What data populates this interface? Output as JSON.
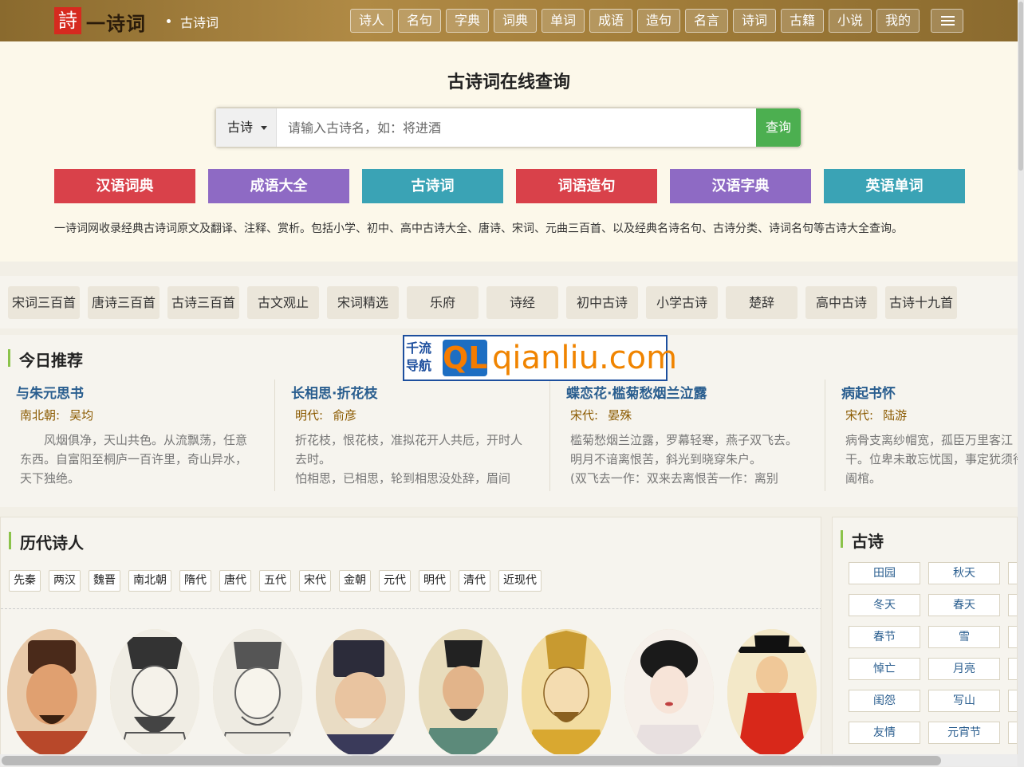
{
  "header": {
    "logo_mark": "詩",
    "logo_text": "一诗词",
    "breadcrumb": "古诗词",
    "nav": [
      "诗人",
      "名句",
      "字典",
      "词典",
      "单词",
      "成语",
      "造句",
      "名言",
      "诗词",
      "古籍",
      "小说",
      "我的"
    ]
  },
  "hero": {
    "title": "古诗词在线查询",
    "search_type": "古诗",
    "search_placeholder": "请输入古诗名，如：将进酒",
    "search_button": "查询",
    "quick_links": [
      {
        "label": "汉语词典",
        "color": "#d9414a"
      },
      {
        "label": "成语大全",
        "color": "#8e6ac4"
      },
      {
        "label": "古诗词",
        "color": "#3aa3b5"
      },
      {
        "label": "词语造句",
        "color": "#d9414a"
      },
      {
        "label": "汉语字典",
        "color": "#8e6ac4"
      },
      {
        "label": "英语单词",
        "color": "#3aa3b5"
      }
    ],
    "description": "一诗词网收录经典古诗词原文及翻译、注释、赏析。包括小学、初中、高中古诗大全、唐诗、宋词、元曲三百首、以及经典名诗名句、古诗分类、诗词名句等古诗大全查询。"
  },
  "collections": [
    "宋词三百首",
    "唐诗三百首",
    "古诗三百首",
    "古文观止",
    "宋词精选",
    "乐府",
    "诗经",
    "初中古诗",
    "小学古诗",
    "楚辞",
    "高中古诗",
    "古诗十九首"
  ],
  "watermark": {
    "line1": "千流",
    "line2": "导航",
    "ql": "QL",
    "url": "qianliu.com"
  },
  "today": {
    "title": "今日推荐",
    "poems": [
      {
        "title": "与朱元思书",
        "dynasty": "南北朝:",
        "author": "吴均",
        "text": "　　风烟俱净，天山共色。从流飘荡，任意东西。自富阳至桐庐一百许里，奇山异水，天下独绝。"
      },
      {
        "title": "长相思·折花枝",
        "dynasty": "明代:",
        "author": "俞彦",
        "text": "折花枝，恨花枝，准拟花开人共卮，开时人去时。\n怕相思，已相思，轮到相思没处辞，眉间"
      },
      {
        "title": "蝶恋花·槛菊愁烟兰泣露",
        "dynasty": "宋代:",
        "author": "晏殊",
        "text": "槛菊愁烟兰泣露，罗幕轻寒，燕子双飞去。明月不谙离恨苦，斜光到晓穿朱户。\n(双飞去一作：双来去离恨苦一作：离别"
      },
      {
        "title": "病起书怀",
        "dynasty": "宋代:",
        "author": "陆游",
        "text": "病骨支离纱帽宽，孤臣万里客江干。位卑未敢忘忧国，事定犹须待阖棺。"
      }
    ]
  },
  "poets": {
    "title": "历代诗人",
    "eras": [
      "先秦",
      "两汉",
      "魏晋",
      "南北朝",
      "隋代",
      "唐代",
      "五代",
      "宋代",
      "金朝",
      "元代",
      "明代",
      "清代",
      "近现代"
    ]
  },
  "categories": {
    "title": "古诗",
    "items": [
      "田园",
      "秋天",
      "冬天",
      "春天",
      "春节",
      "雪",
      "悼亡",
      "月亮",
      "闺怨",
      "写山",
      "友情",
      "元宵节"
    ]
  }
}
